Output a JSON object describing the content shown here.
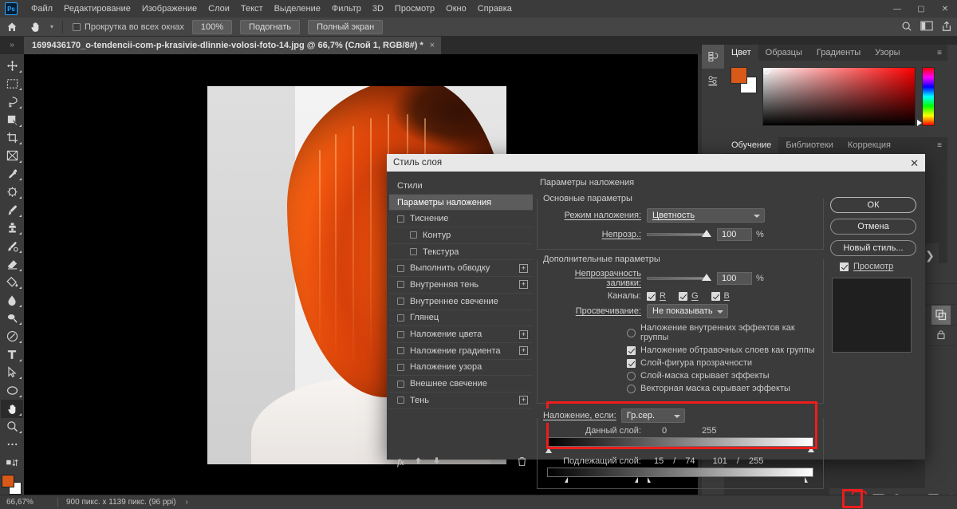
{
  "app": {
    "logo": "Ps",
    "menu": [
      "Файл",
      "Редактирование",
      "Изображение",
      "Слои",
      "Текст",
      "Выделение",
      "Фильтр",
      "3D",
      "Просмотр",
      "Окно",
      "Справка"
    ],
    "window_controls": [
      "minimize",
      "maximize",
      "close"
    ]
  },
  "options_bar": {
    "home_icon": "home-icon",
    "tool_icon": "hand-tool-icon",
    "scroll_all_windows": {
      "label": "Прокрутка во всех окнах",
      "checked": false
    },
    "buttons": [
      "100%",
      "Подогнать",
      "Полный экран"
    ],
    "right_icons": [
      "search-icon",
      "workspace-icon",
      "share-icon"
    ]
  },
  "tab_bar": {
    "arrows": "»",
    "title": "1699436170_o-tendencii-com-p-krasivie-dlinnie-volosi-foto-14.jpg @ 66,7% (Слой 1, RGB/8#) *",
    "close": "×"
  },
  "toolbar": {
    "tools": [
      {
        "name": "move-tool",
        "glyph": "move"
      },
      {
        "name": "rectangular-marquee-tool",
        "glyph": "marquee"
      },
      {
        "name": "lasso-tool",
        "glyph": "lasso"
      },
      {
        "name": "object-selection-tool",
        "glyph": "quickselect"
      },
      {
        "name": "crop-tool",
        "glyph": "crop"
      },
      {
        "name": "frame-tool",
        "glyph": "frame"
      },
      {
        "name": "eyedropper-tool",
        "glyph": "eyedropper"
      },
      {
        "name": "spot-healing-brush-tool",
        "glyph": "healing"
      },
      {
        "name": "brush-tool",
        "glyph": "brush"
      },
      {
        "name": "clone-stamp-tool",
        "glyph": "stamp"
      },
      {
        "name": "history-brush-tool",
        "glyph": "historybrush"
      },
      {
        "name": "eraser-tool",
        "glyph": "eraser"
      },
      {
        "name": "gradient-tool",
        "glyph": "paintbucket"
      },
      {
        "name": "blur-tool",
        "glyph": "blur"
      },
      {
        "name": "dodge-tool",
        "glyph": "dodge"
      },
      {
        "name": "pen-tool",
        "glyph": "pen"
      },
      {
        "name": "type-tool",
        "glyph": "type"
      },
      {
        "name": "path-selection-tool",
        "glyph": "pathselect"
      },
      {
        "name": "ellipse-tool",
        "glyph": "ellipse"
      },
      {
        "name": "hand-tool",
        "glyph": "hand",
        "active": true
      },
      {
        "name": "zoom-tool",
        "glyph": "zoom"
      },
      {
        "name": "more-tools",
        "glyph": "dots"
      },
      {
        "name": "edit-toolbar",
        "glyph": "editbar"
      }
    ],
    "foreground_color": "#d95918",
    "background_color": "#ffffff"
  },
  "panels": {
    "color": {
      "tabs": [
        "Цвет",
        "Образцы",
        "Градиенты",
        "Узоры"
      ],
      "active_tab": "Цвет",
      "foreground_color": "#d95918",
      "background_color": "#ffffff",
      "menu_icon": "panel-menu-icon"
    },
    "learn": {
      "tabs": [
        "Обучение",
        "Библиотеки",
        "Коррекция"
      ],
      "active_tab": "Обучение",
      "menu_icon": "panel-menu-icon"
    },
    "layers_footer_icons": [
      "link-icon",
      "fx-icon",
      "mask-icon",
      "adjustment-icon",
      "folder-icon",
      "new-layer-icon",
      "trash-icon"
    ],
    "highlighted_footer_icon": "fx-icon"
  },
  "status_bar": {
    "zoom": "66,67%",
    "dimensions": "900 пикс. x 1139 пикс. (96 ppi)",
    "arrow": "›"
  },
  "dialog": {
    "title": "Стиль слоя",
    "close": "✕",
    "styles": [
      {
        "label": "Стили",
        "checkbox": false,
        "indent": 0,
        "plus": false,
        "active": false
      },
      {
        "label": "Параметры наложения",
        "checkbox": false,
        "indent": 0,
        "plus": false,
        "active": true
      },
      {
        "label": "Тиснение",
        "checkbox": true,
        "indent": 0,
        "plus": false,
        "active": false
      },
      {
        "label": "Контур",
        "checkbox": true,
        "indent": 1,
        "plus": false,
        "active": false
      },
      {
        "label": "Текстура",
        "checkbox": true,
        "indent": 1,
        "plus": false,
        "active": false
      },
      {
        "label": "Выполнить обводку",
        "checkbox": true,
        "indent": 0,
        "plus": true,
        "active": false
      },
      {
        "label": "Внутренняя тень",
        "checkbox": true,
        "indent": 0,
        "plus": true,
        "active": false
      },
      {
        "label": "Внутреннее свечение",
        "checkbox": true,
        "indent": 0,
        "plus": false,
        "active": false
      },
      {
        "label": "Глянец",
        "checkbox": true,
        "indent": 0,
        "plus": false,
        "active": false
      },
      {
        "label": "Наложение цвета",
        "checkbox": true,
        "indent": 0,
        "plus": true,
        "active": false
      },
      {
        "label": "Наложение градиента",
        "checkbox": true,
        "indent": 0,
        "plus": true,
        "active": false
      },
      {
        "label": "Наложение узора",
        "checkbox": true,
        "indent": 0,
        "plus": false,
        "active": false
      },
      {
        "label": "Внешнее свечение",
        "checkbox": true,
        "indent": 0,
        "plus": false,
        "active": false
      },
      {
        "label": "Тень",
        "checkbox": true,
        "indent": 0,
        "plus": true,
        "active": false
      }
    ],
    "fx_bar": {
      "fx": "fx",
      "up": "▲",
      "down": "▼",
      "trash": "trash-icon"
    },
    "blending_options": {
      "section_title": "Параметры наложения",
      "general": {
        "legend": "Основные параметры",
        "blend_mode_label": "Режим наложения:",
        "blend_mode_value": "Цветность",
        "opacity_label": "Непрозр.:",
        "opacity_value": "100",
        "opacity_unit": "%"
      },
      "advanced": {
        "legend": "Дополнительные параметры",
        "fill_opacity_label": "Непрозрачность заливки:",
        "fill_opacity_value": "100",
        "fill_opacity_unit": "%",
        "channels_label": "Каналы:",
        "channels": [
          {
            "label": "R",
            "checked": true
          },
          {
            "label": "G",
            "checked": true
          },
          {
            "label": "B",
            "checked": true
          }
        ],
        "knockout_label": "Просвечивание:",
        "knockout_value": "Не показывать",
        "checkboxes": [
          {
            "label": "Наложение внутренних эффектов как группы",
            "checked": false
          },
          {
            "label": "Наложение обтравочных слоев как группы",
            "checked": true
          },
          {
            "label": "Слой-фигура прозрачности",
            "checked": true
          },
          {
            "label": "Слой-маска скрывает эффекты",
            "checked": false
          },
          {
            "label": "Векторная маска скрывает эффекты",
            "checked": false
          }
        ]
      },
      "blend_if": {
        "legend": "Наложение, если:",
        "channel_value": "Гр.сер.",
        "this_layer": {
          "label": "Данный слой:",
          "black": "0",
          "white": "255"
        },
        "underlying_layer": {
          "label": "Подлежащий слой:",
          "black_low": "15",
          "black_high": "74",
          "white_low": "101",
          "white_high": "255"
        },
        "highlight_color": "#ee1c1c"
      }
    },
    "buttons": {
      "ok": "ОК",
      "cancel": "Отмена",
      "new_style": "Новый стиль...",
      "preview_label": "Просмотр",
      "preview_checked": true
    }
  }
}
